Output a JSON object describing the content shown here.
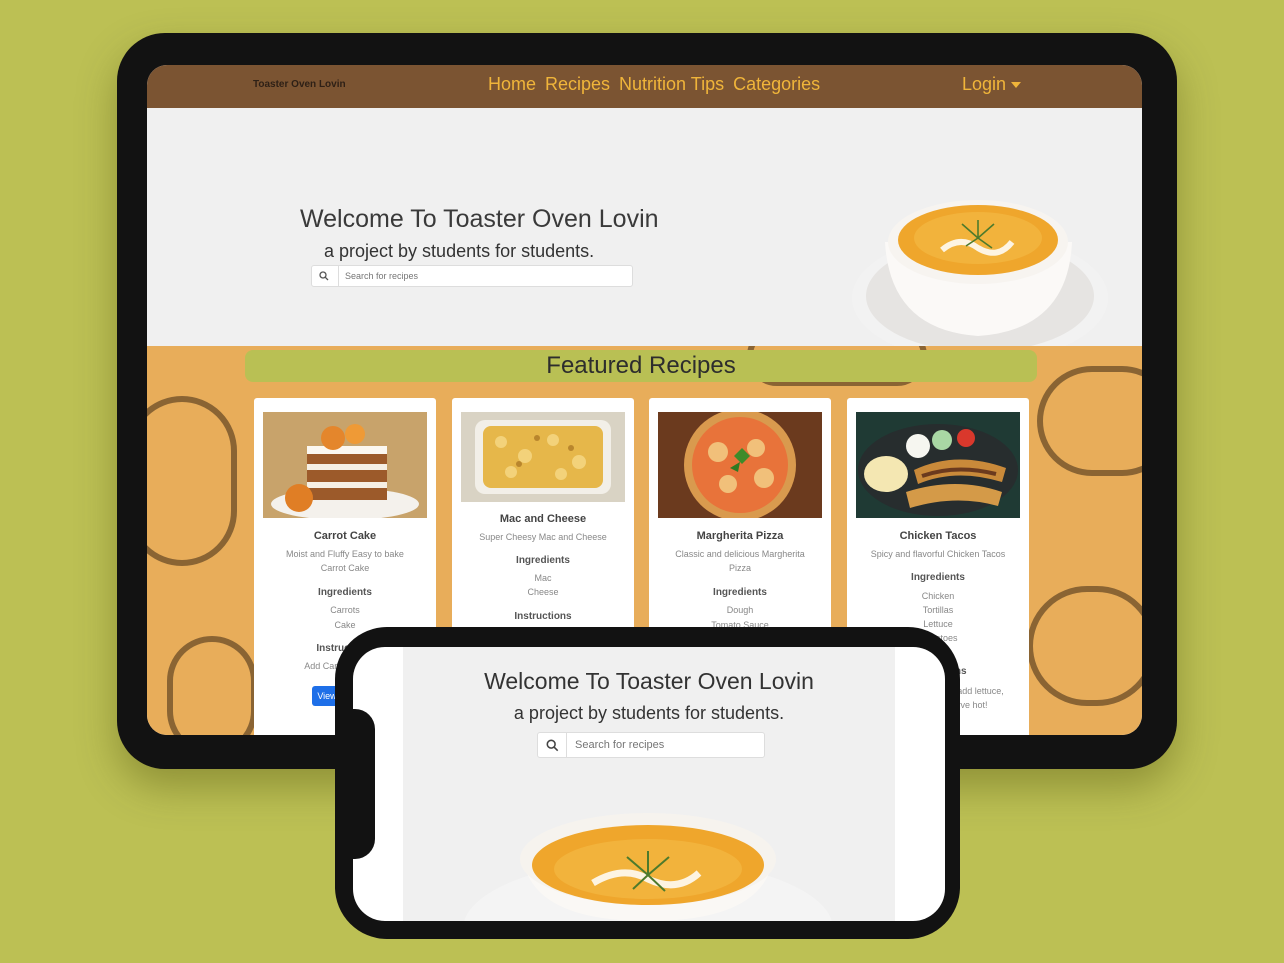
{
  "navbar": {
    "brand": "Toaster Oven Lovin",
    "links": [
      "Home",
      "Recipes",
      "Nutrition Tips",
      "Categories"
    ],
    "login": "Login"
  },
  "hero": {
    "title": "Welcome To Toaster Oven Lovin",
    "subtitle": "a project by students for students.",
    "search_placeholder": "Search for recipes"
  },
  "featured": {
    "title": "Featured Recipes",
    "cards": [
      {
        "title": "Carrot Cake",
        "description": "Moist and Fluffy Easy to bake Carrot Cake",
        "ingredients_label": "Ingredients",
        "ingredients": [
          "Carrots",
          "Cake"
        ],
        "instructions_label": "Instructions",
        "instructions": "Add Carrots to Cake",
        "button": "View"
      },
      {
        "title": "Mac and Cheese",
        "description": "Super Cheesy Mac and Cheese",
        "ingredients_label": "Ingredients",
        "ingredients": [
          "Mac",
          "Cheese"
        ],
        "instructions_label": "Instructions"
      },
      {
        "title": "Margherita Pizza",
        "description": "Classic and delicious Margherita Pizza",
        "ingredients_label": "Ingredients",
        "ingredients": [
          "Dough",
          "Tomato Sauce"
        ]
      },
      {
        "title": "Chicken Tacos",
        "description": "Spicy and flavorful Chicken Tacos",
        "ingredients_label": "Ingredients",
        "ingredients": [
          "Chicken",
          "Tortillas",
          "Lettuce",
          "Tomatoes"
        ],
        "instructions_label": "Instructions",
        "instructions": "Assemble in tortillas, add lettuce, tomatoes, and serve hot!"
      }
    ]
  },
  "colors": {
    "background": "#bcc054",
    "navbar": "#7b5432",
    "nav_text": "#f0b53a",
    "featured_bg": "#e8ad5a",
    "featured_bar": "#b9c054",
    "button": "#1e6fe8"
  }
}
